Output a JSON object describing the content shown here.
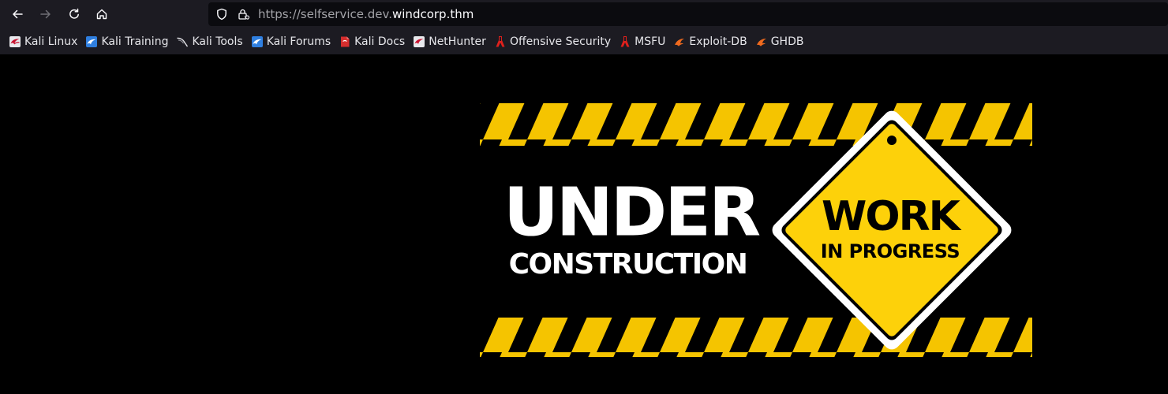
{
  "toolbar": {
    "url_prefix": "https://selfservice.dev.",
    "url_host": "windcorp.thm"
  },
  "bookmarks": [
    {
      "label": "Kali Linux",
      "icon": "kali-dragon-icon"
    },
    {
      "label": "Kali Training",
      "icon": "kali-training-icon"
    },
    {
      "label": "Kali Tools",
      "icon": "kali-tools-icon"
    },
    {
      "label": "Kali Forums",
      "icon": "kali-forums-icon"
    },
    {
      "label": "Kali Docs",
      "icon": "kali-docs-icon"
    },
    {
      "label": "NetHunter",
      "icon": "nethunter-icon"
    },
    {
      "label": "Offensive Security",
      "icon": "offsec-icon"
    },
    {
      "label": "MSFU",
      "icon": "msfu-icon"
    },
    {
      "label": "Exploit-DB",
      "icon": "exploit-db-icon"
    },
    {
      "label": "GHDB",
      "icon": "ghdb-icon"
    }
  ],
  "banner": {
    "line1": "UNDER",
    "line2": "CONSTRUCTION",
    "sign_line1": "WORK",
    "sign_line2": "IN PROGRESS"
  },
  "colors": {
    "stripe_yellow": "#f5c400",
    "sign_yellow": "#fdd10a",
    "chrome": "#1c1b22",
    "urlbar": "#0b0b0f"
  }
}
